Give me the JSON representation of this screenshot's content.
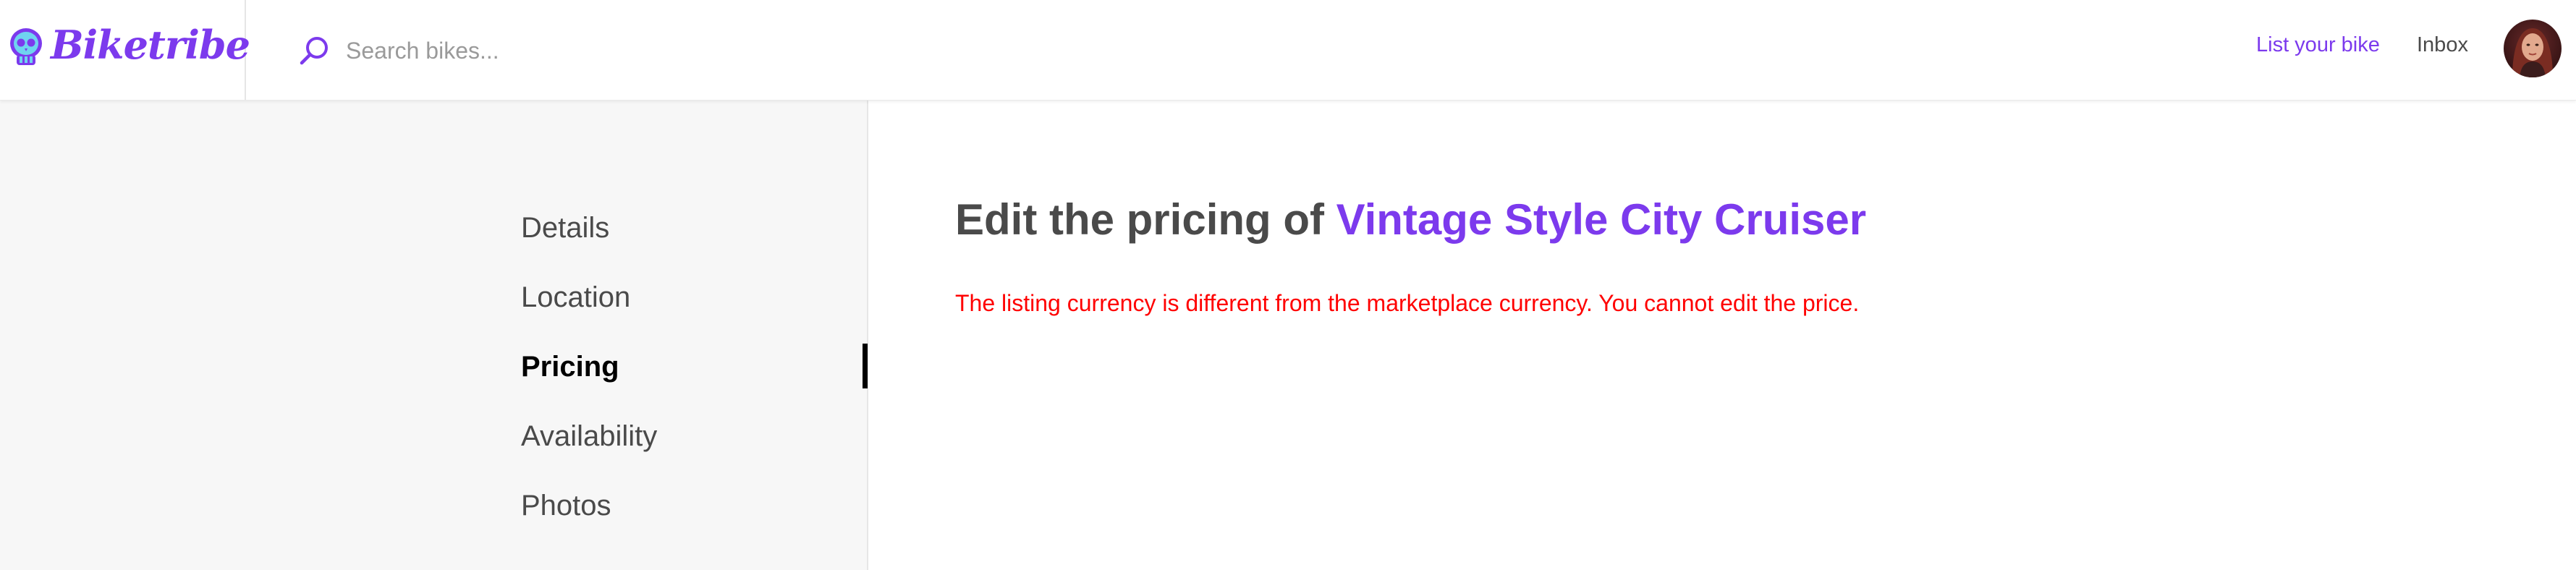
{
  "brand": {
    "name": "Biketribe",
    "accent_color": "#7c3aed"
  },
  "topbar": {
    "search": {
      "placeholder": "Search bikes...",
      "value": "",
      "icon": "search-icon"
    },
    "links": {
      "list_your_bike": "List your bike",
      "inbox": "Inbox"
    },
    "avatar_icon": "user-avatar"
  },
  "sidebar": {
    "items": [
      {
        "label": "Details",
        "active": false
      },
      {
        "label": "Location",
        "active": false
      },
      {
        "label": "Pricing",
        "active": true
      },
      {
        "label": "Availability",
        "active": false
      },
      {
        "label": "Photos",
        "active": false
      }
    ]
  },
  "main": {
    "title_prefix": "Edit the pricing of",
    "listing_name": "Vintage Style City Cruiser",
    "error": "The listing currency is different from the marketplace currency. You cannot edit the price.",
    "error_color": "#ff0000"
  }
}
